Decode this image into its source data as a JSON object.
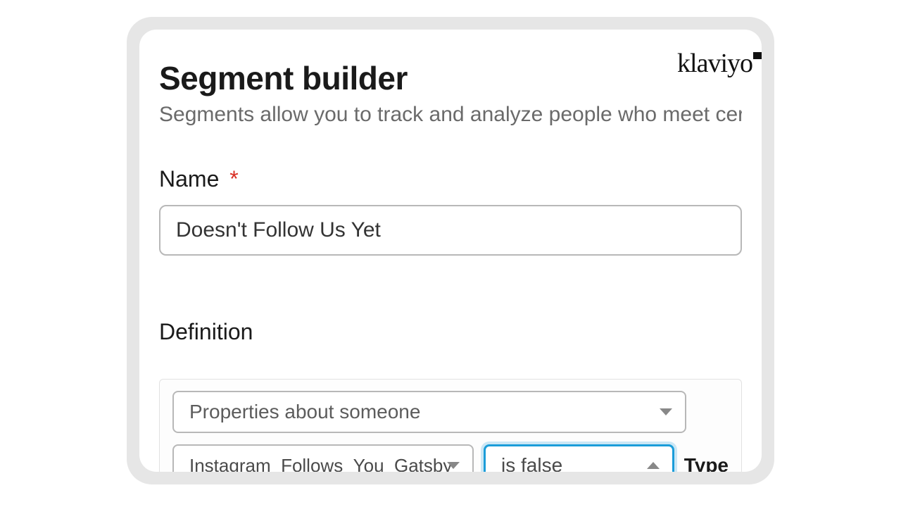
{
  "logo": {
    "text": "klaviyo"
  },
  "header": {
    "title": "Segment builder",
    "subtitle": "Segments allow you to track and analyze people who meet certain criteria."
  },
  "name_field": {
    "label": "Name",
    "required_marker": "*",
    "value": "Doesn't Follow Us Yet"
  },
  "definition": {
    "heading": "Definition",
    "condition_type": "Properties about someone",
    "property": "Instagram_Follows_You_Gatsby",
    "operator": "is false",
    "type_label": "Type"
  }
}
